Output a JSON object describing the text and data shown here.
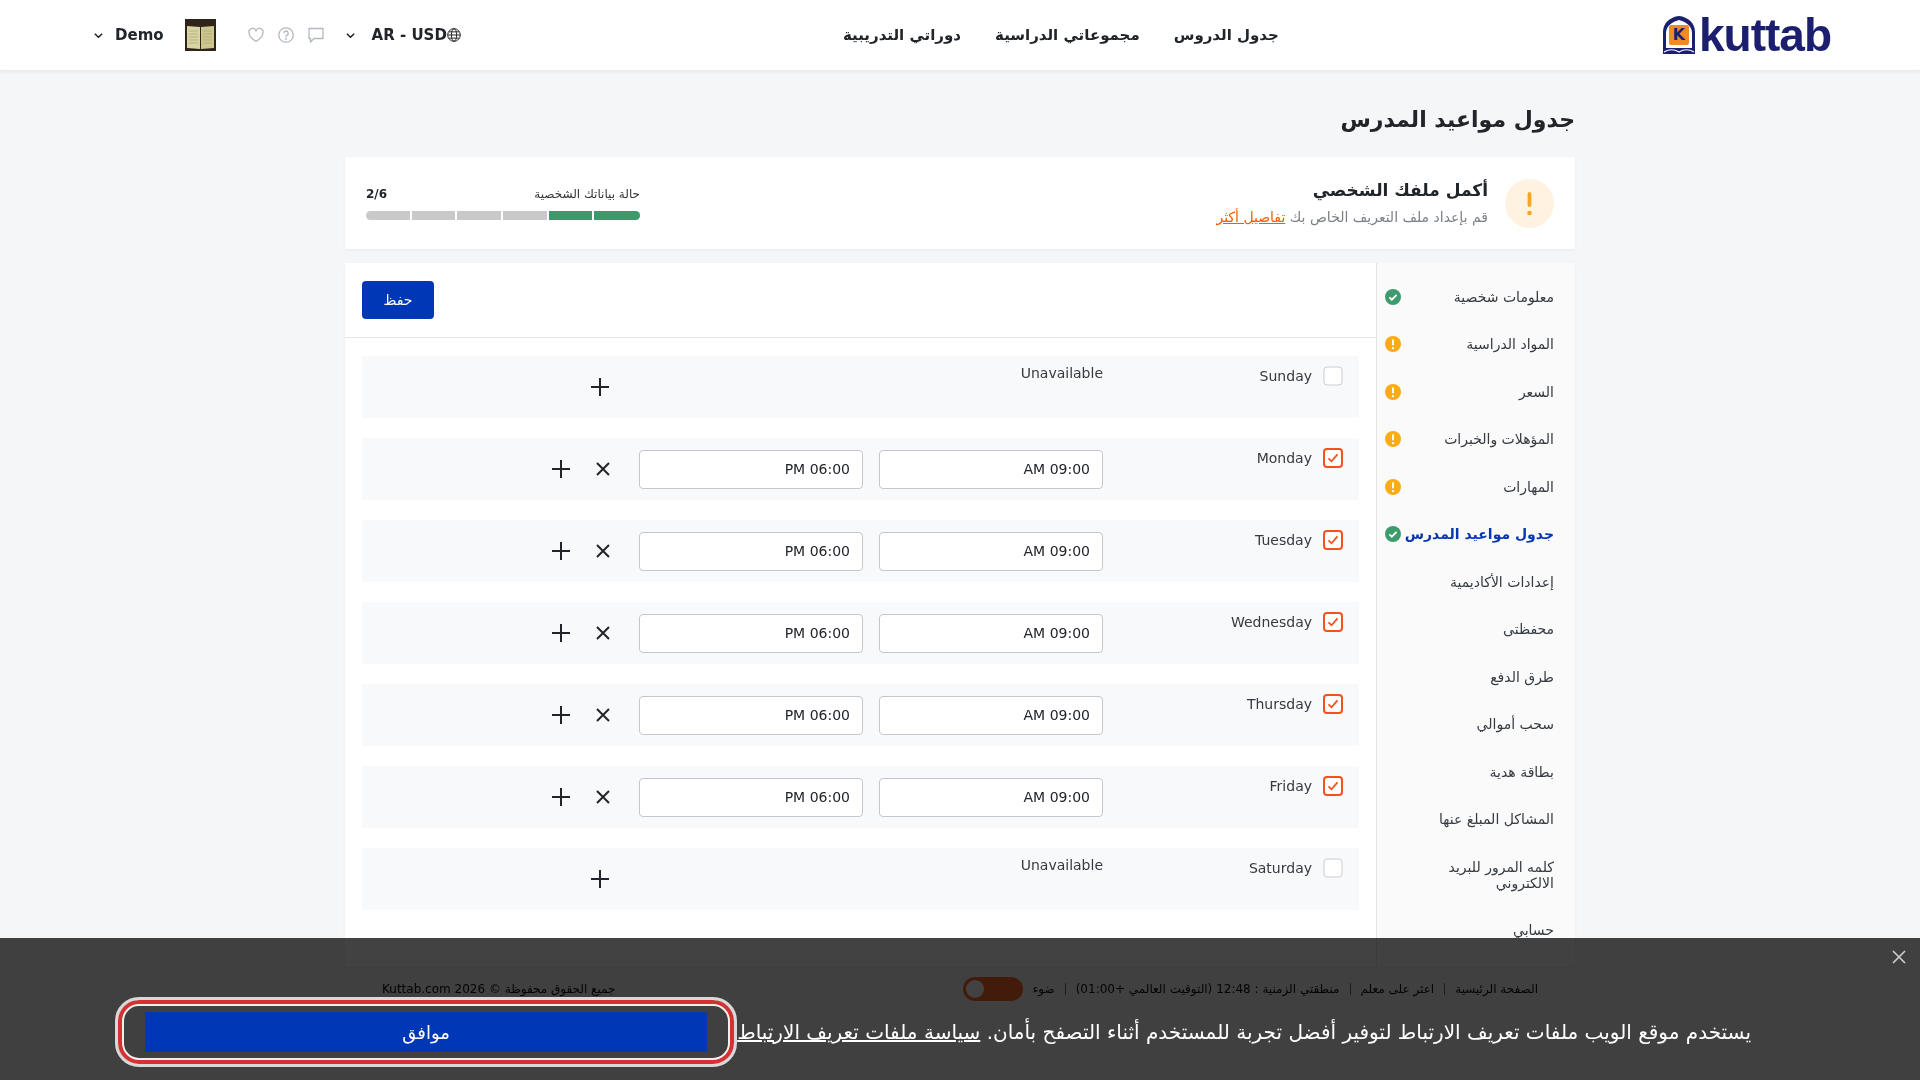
{
  "header": {
    "logo": {
      "mark_letter": "K",
      "text": "kuttab"
    },
    "nav": [
      {
        "label": "جدول الدروس"
      },
      {
        "label": "مجموعاتي الدراسية"
      },
      {
        "label": "دوراتي التدريبية"
      }
    ],
    "locale": "AR - USD",
    "user": {
      "name": "Demo"
    }
  },
  "page_title": "جدول مواعيد المدرس",
  "profile_alert": {
    "title": "أكمل ملفك الشخصي",
    "text": "قم بإعداد ملف التعريف الخاص بك",
    "link": "تفاصيل أكثر",
    "progress": {
      "label": "حالة بياناتك الشخصية",
      "count": "2/6",
      "level": 0.3333
    }
  },
  "schedule": {
    "save_button": "حفظ",
    "days": [
      {
        "name": "Sunday",
        "checked": false,
        "unavailable_label": "Unavailable"
      },
      {
        "name": "Monday",
        "checked": true,
        "slots": [
          {
            "start": "AM 09:00",
            "end": "PM 06:00"
          }
        ]
      },
      {
        "name": "Tuesday",
        "checked": true,
        "slots": [
          {
            "start": "AM 09:00",
            "end": "PM 06:00"
          }
        ]
      },
      {
        "name": "Wednesday",
        "checked": true,
        "slots": [
          {
            "start": "AM 09:00",
            "end": "PM 06:00"
          }
        ]
      },
      {
        "name": "Thursday",
        "checked": true,
        "slots": [
          {
            "start": "AM 09:00",
            "end": "PM 06:00"
          }
        ]
      },
      {
        "name": "Friday",
        "checked": true,
        "slots": [
          {
            "start": "AM 09:00",
            "end": "PM 06:00"
          }
        ]
      },
      {
        "name": "Saturday",
        "checked": false,
        "unavailable_label": "Unavailable"
      }
    ]
  },
  "sidebar": {
    "items": [
      {
        "label": "معلومات شخصية",
        "done": true,
        "selected": false
      },
      {
        "label": "المواد الدراسية",
        "done": false,
        "selected": false
      },
      {
        "label": "السعر",
        "done": false,
        "selected": false
      },
      {
        "label": "المؤهلات والخبرات",
        "done": false,
        "selected": false
      },
      {
        "label": "المهارات",
        "done": false,
        "selected": false
      },
      {
        "label": "جدول مواعيد المدرس",
        "done": true,
        "selected": true
      },
      {
        "label": "إعدادات الأكاديمية",
        "selected": false
      },
      {
        "label": "محفظتى",
        "selected": false
      },
      {
        "label": "طرق الدفع",
        "selected": false
      },
      {
        "label": "سحب أموالي",
        "selected": false
      },
      {
        "label": "بطاقة هدية",
        "selected": false
      },
      {
        "label": "المشاكل المبلغ عنها",
        "selected": false
      },
      {
        "label": "كلمه المرور للبريد الالكتروني",
        "selected": false
      },
      {
        "label": "حسابي",
        "selected": false
      }
    ]
  },
  "footer": {
    "links": [
      {
        "label": "الصفحة الرئيسية"
      },
      {
        "label": "اعثر على معلم"
      }
    ],
    "timezone": "منطقتي الزمنية : 12:48 (التوقيت العالمي +01:00)",
    "theme_toggle": {
      "label": "ضوء",
      "on": true
    },
    "copyright": "جميع الحقوق محفوظة © Kuttab.com 2026"
  },
  "cookie_banner": {
    "text": "يستخدم موقع الويب ملفات تعريف الارتباط لتوفير أفضل تجربة للمستخدم أثناء التصفح بأمان.",
    "link": "سياسة ملفات تعريف الارتباط",
    "button": "موافق"
  }
}
